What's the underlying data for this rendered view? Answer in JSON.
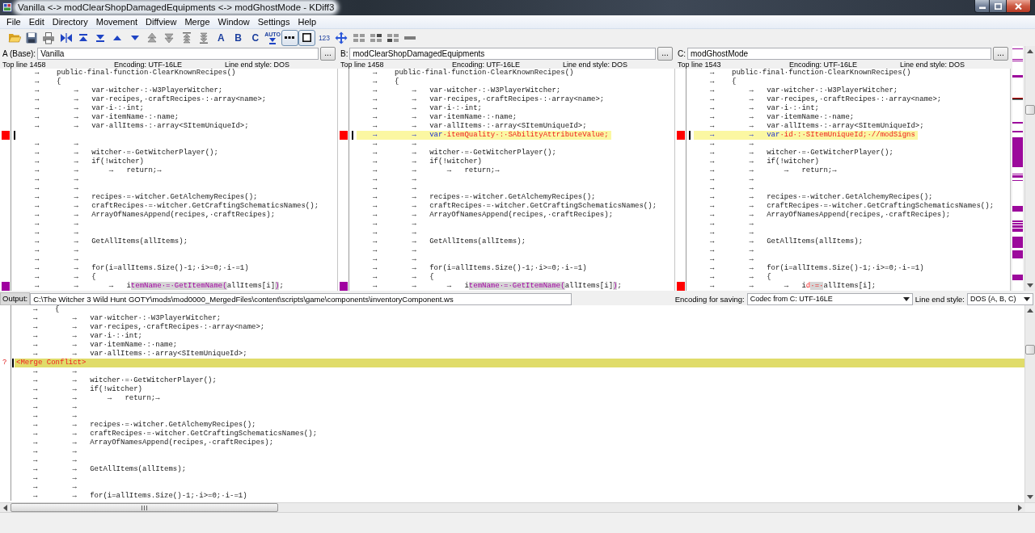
{
  "window": {
    "title": "Vanilla <-> modClearShopDamagedEquipments <-> modGhostMode - KDiff3"
  },
  "menu": [
    "File",
    "Edit",
    "Directory",
    "Movement",
    "Diffview",
    "Merge",
    "Window",
    "Settings",
    "Help"
  ],
  "toolbar": {
    "letter_buttons": [
      {
        "label": "A"
      },
      {
        "label": "B"
      },
      {
        "label": "C"
      }
    ],
    "auto_button": {
      "label": "AUTO"
    },
    "toggle_buttons": [
      {
        "checked": true
      },
      {
        "checked": true
      }
    ],
    "number_button": {
      "label": "123"
    }
  },
  "panes": [
    {
      "label": "A (Base):",
      "file": "Vanilla",
      "browse": "...",
      "top_line": "Top line 1458",
      "encoding": "Encoding: UTF-16LE",
      "line_end": "Line end style: DOS",
      "lines": [
        {
          "text": "→    public·final·function·ClearKnownRecipes()",
          "current": false
        },
        {
          "text": "→    {",
          "current": false
        },
        {
          "text": "→        →   var·witcher·:·W3PlayerWitcher;",
          "current": false
        },
        {
          "text": "→        →   var·recipes,·craftRecipes·:·array<name>;",
          "current": false
        },
        {
          "text": "→        →   var·i·:·int;",
          "current": false
        },
        {
          "text": "→        →   var·itemName·:·name;",
          "current": false
        },
        {
          "text": "→        →   var·allItems·:·array<SItemUniqueId>;",
          "current": false
        },
        {
          "current": true,
          "color": "#ff0000"
        },
        {
          "text": "→        →",
          "current": false
        },
        {
          "text": "→        →   witcher·=·GetWitcherPlayer();",
          "current": false
        },
        {
          "text": "→        →   if(!witcher)",
          "current": false
        },
        {
          "text": "→        →       →   return;→",
          "current": false
        },
        {
          "text": "→        →",
          "current": false
        },
        {
          "text": "→        →",
          "current": false
        },
        {
          "text": "→        →   recipes·=·witcher.GetAlchemyRecipes();",
          "current": false
        },
        {
          "text": "→        →   craftRecipes·=·witcher.GetCraftingSchematicsNames();",
          "current": false
        },
        {
          "text": "→        →   ArrayOfNamesAppend(recipes,·craftRecipes);",
          "current": false
        },
        {
          "text": "→        →",
          "current": false
        },
        {
          "text": "→        →",
          "current": false
        },
        {
          "text": "→        →   GetAllItems(allItems);",
          "current": false
        },
        {
          "text": "→        →",
          "current": false
        },
        {
          "text": "→        →",
          "current": false
        },
        {
          "text": "→        →   for(i=allItems.Size()-1;·i>=0;·i-=1)",
          "current": false
        },
        {
          "text": "→        →   {",
          "current": false
        },
        {
          "segments": [
            {
              "text": "→        →       →   i",
              "kind": "same",
              "highlight": false
            },
            {
              "text": "temName·=·GetItemName(",
              "kind": "pair",
              "highlight": true
            },
            {
              "text": "allItems[i]",
              "kind": "same",
              "highlight": false
            },
            {
              "text": ")",
              "kind": "pair",
              "highlight": true
            },
            {
              "text": ";",
              "kind": "same",
              "highlight": false
            }
          ],
          "current": false,
          "color": "#a000a0"
        }
      ]
    },
    {
      "label": "B:",
      "file": "modClearShopDamagedEquipments",
      "browse": "...",
      "top_line": "Top line 1458",
      "encoding": "Encoding: UTF-16LE",
      "line_end": "Line end style: DOS",
      "lines": [
        {
          "text": "→    public·final·function·ClearKnownRecipes()",
          "current": false
        },
        {
          "text": "→    {",
          "current": false
        },
        {
          "text": "→        →   var·witcher·:·W3PlayerWitcher;",
          "current": false
        },
        {
          "text": "→        →   var·recipes,·craftRecipes·:·array<name>;",
          "current": false
        },
        {
          "text": "→        →   var·i·:·int;",
          "current": false
        },
        {
          "text": "→        →   var·itemName·:·name;",
          "current": false
        },
        {
          "text": "→        →   var·allItems·:·array<SItemUniqueId>;",
          "current": false
        },
        {
          "segments": [
            {
              "text": "→        →   var",
              "kind": "common",
              "highlight": false
            },
            {
              "text": "·itemQuality·:·SAbilityAttributeValue;",
              "kind": "unique",
              "highlight": false
            }
          ],
          "current": true,
          "color": "#ff0000"
        },
        {
          "text": "→        →",
          "current": false
        },
        {
          "text": "→        →   witcher·=·GetWitcherPlayer();",
          "current": false
        },
        {
          "text": "→        →   if(!witcher)",
          "current": false
        },
        {
          "text": "→        →       →   return;→",
          "current": false
        },
        {
          "text": "→        →",
          "current": false
        },
        {
          "text": "→        →",
          "current": false
        },
        {
          "text": "→        →   recipes·=·witcher.GetAlchemyRecipes();",
          "current": false
        },
        {
          "text": "→        →   craftRecipes·=·witcher.GetCraftingSchematicsNames();",
          "current": false
        },
        {
          "text": "→        →   ArrayOfNamesAppend(recipes,·craftRecipes);",
          "current": false
        },
        {
          "text": "→        →",
          "current": false
        },
        {
          "text": "→        →",
          "current": false
        },
        {
          "text": "→        →   GetAllItems(allItems);",
          "current": false
        },
        {
          "text": "→        →",
          "current": false
        },
        {
          "text": "→        →",
          "current": false
        },
        {
          "text": "→        →   for(i=allItems.Size()-1;·i>=0;·i-=1)",
          "current": false
        },
        {
          "text": "→        →   {",
          "current": false
        },
        {
          "segments": [
            {
              "text": "→        →       →   i",
              "kind": "same",
              "highlight": false
            },
            {
              "text": "temName·=·GetItemName(",
              "kind": "pair",
              "highlight": true
            },
            {
              "text": "allItems[i]",
              "kind": "same",
              "highlight": false
            },
            {
              "text": ")",
              "kind": "pair",
              "highlight": true
            },
            {
              "text": ";",
              "kind": "same",
              "highlight": false
            }
          ],
          "current": false,
          "color": "#a000a0"
        }
      ]
    },
    {
      "label": "C:",
      "file": "modGhostMode",
      "browse": "...",
      "top_line": "Top line 1543",
      "encoding": "Encoding: UTF-16LE",
      "line_end": "Line end style: DOS",
      "lines": [
        {
          "text": "→    public·final·function·ClearKnownRecipes()",
          "current": false
        },
        {
          "text": "→    {",
          "current": false
        },
        {
          "text": "→        →   var·witcher·:·W3PlayerWitcher;",
          "current": false
        },
        {
          "text": "→        →   var·recipes,·craftRecipes·:·array<name>;",
          "current": false
        },
        {
          "text": "→        →   var·i·:·int;",
          "current": false
        },
        {
          "text": "→        →   var·itemName·:·name;",
          "current": false
        },
        {
          "text": "→        →   var·allItems·:·array<SItemUniqueId>;",
          "current": false
        },
        {
          "segments": [
            {
              "text": "→        →   var",
              "kind": "common",
              "highlight": false
            },
            {
              "text": "·id·:·SItemUniqueId;·//modSigns",
              "kind": "unique",
              "highlight": false
            }
          ],
          "current": true,
          "color": "#ff0000"
        },
        {
          "text": "→        →",
          "current": false
        },
        {
          "text": "→        →   witcher·=·GetWitcherPlayer();",
          "current": false
        },
        {
          "text": "→        →   if(!witcher)",
          "current": false
        },
        {
          "text": "→        →       →   return;→",
          "current": false
        },
        {
          "text": "→        →",
          "current": false
        },
        {
          "text": "→        →",
          "current": false
        },
        {
          "text": "→        →   recipes·=·witcher.GetAlchemyRecipes();",
          "current": false
        },
        {
          "text": "→        →   craftRecipes·=·witcher.GetCraftingSchematicsNames();",
          "current": false
        },
        {
          "text": "→        →   ArrayOfNamesAppend(recipes,·craftRecipes);",
          "current": false
        },
        {
          "text": "→        →",
          "current": false
        },
        {
          "text": "→        →",
          "current": false
        },
        {
          "text": "→        →   GetAllItems(allItems);",
          "current": false
        },
        {
          "text": "→        →",
          "current": false
        },
        {
          "text": "→        →",
          "current": false
        },
        {
          "text": "→        →   for(i=allItems.Size()-1;·i>=0;·i-=1)",
          "current": false
        },
        {
          "text": "→        →   {",
          "current": false
        },
        {
          "segments": [
            {
              "text": "→        →       →   i",
              "kind": "same",
              "highlight": false
            },
            {
              "text": "d",
              "kind": "unique",
              "highlight": false
            },
            {
              "text": "·=·",
              "kind": "unique",
              "highlight": true
            },
            {
              "text": "allItems[i];",
              "kind": "same",
              "highlight": false
            }
          ],
          "current": false,
          "color": "#ff0000"
        }
      ]
    }
  ],
  "output": {
    "label": "Output:",
    "path": "C:\\The Witcher 3 Wild Hunt GOTY\\mods\\mod0000_MergedFiles\\content\\scripts\\game\\components\\inventoryComponent.ws",
    "encoding_label": "Encoding for saving:",
    "encoding": "Codec from C: UTF-16LE",
    "line_end_label": "Line end style:",
    "line_end": "DOS (A, B, C)",
    "lines": [
      {
        "kind": "code",
        "text": "→    {",
        "current": false
      },
      {
        "kind": "code",
        "text": "→        →   var·witcher·:·W3PlayerWitcher;",
        "current": false
      },
      {
        "kind": "code",
        "text": "→        →   var·recipes,·craftRecipes·:·array<name>;",
        "current": false
      },
      {
        "kind": "code",
        "text": "→        →   var·i·:·int;",
        "current": false
      },
      {
        "kind": "code",
        "text": "→        →   var·itemName·:·name;",
        "current": false
      },
      {
        "kind": "code",
        "text": "→        →   var·allItems·:·array<SItemUniqueId>;",
        "current": false
      },
      {
        "kind": "conflict",
        "text": "<Merge Conflict>",
        "current": true,
        "gutter": "?"
      },
      {
        "kind": "code",
        "text": "→        →",
        "current": false
      },
      {
        "kind": "code",
        "text": "→        →   witcher·=·GetWitcherPlayer();",
        "current": false
      },
      {
        "kind": "code",
        "text": "→        →   if(!witcher)",
        "current": false
      },
      {
        "kind": "code",
        "text": "→        →       →   return;→",
        "current": false
      },
      {
        "kind": "code",
        "text": "→        →",
        "current": false
      },
      {
        "kind": "code",
        "text": "→        →",
        "current": false
      },
      {
        "kind": "code",
        "text": "→        →   recipes·=·witcher.GetAlchemyRecipes();",
        "current": false
      },
      {
        "kind": "code",
        "text": "→        →   craftRecipes·=·witcher.GetCraftingSchematicsNames();",
        "current": false
      },
      {
        "kind": "code",
        "text": "→        →   ArrayOfNamesAppend(recipes,·craftRecipes);",
        "current": false
      },
      {
        "kind": "code",
        "text": "→        →",
        "current": false
      },
      {
        "kind": "code",
        "text": "→        →",
        "current": false
      },
      {
        "kind": "code",
        "text": "→        →   GetAllItems(allItems);",
        "current": false
      },
      {
        "kind": "code",
        "text": "→        →",
        "current": false
      },
      {
        "kind": "code",
        "text": "→        →",
        "current": false
      },
      {
        "kind": "code",
        "text": "→        →   for(i=allItems.Size()-1;·i>=0;·i-=1)",
        "current": false
      }
    ]
  }
}
